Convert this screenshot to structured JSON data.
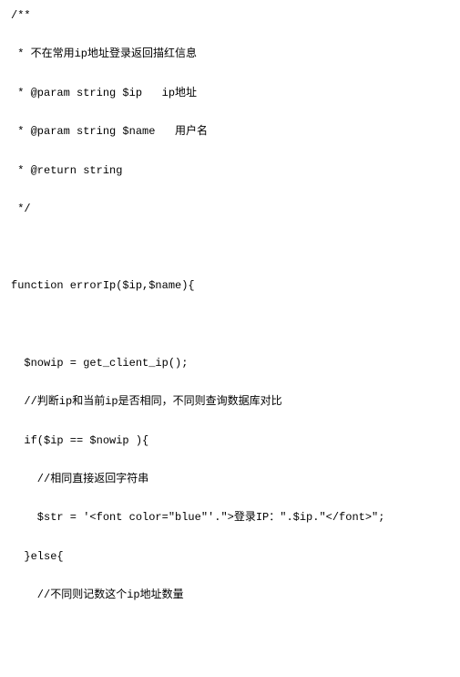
{
  "code": {
    "l1": "/**",
    "l2": " * 不在常用ip地址登录返回描红信息",
    "l3": " * @param string $ip   ip地址",
    "l4": " * @param string $name   用户名",
    "l5": " * @return string",
    "l6": " */",
    "l7": "function errorIp($ip,$name){",
    "l8": "  $nowip = get_client_ip();",
    "l9": "  //判断ip和当前ip是否相同，不同则查询数据库对比",
    "l10": "  if($ip == $nowip ){",
    "l11": "    //相同直接返回字符串",
    "l12": "    $str = '<font color=\"blue\"'.\">登录IP：\".$ip.\"</font>\";",
    "l13": "  }else{",
    "l14": "    //不同则记数这个ip地址数量"
  }
}
